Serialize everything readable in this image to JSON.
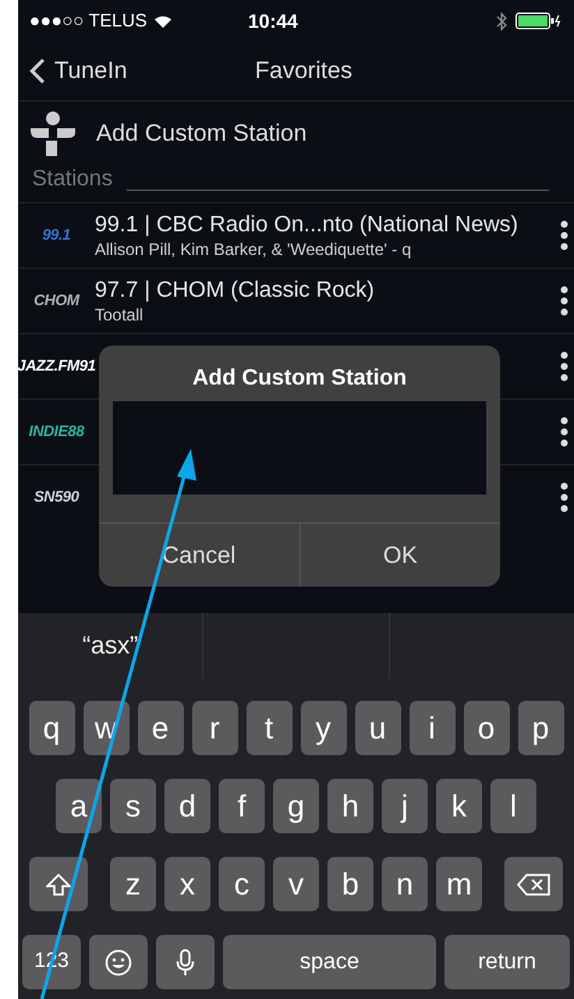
{
  "status_bar": {
    "carrier": "●●●○○ TELUS",
    "time": "10:44"
  },
  "nav": {
    "back": "TuneIn",
    "title": "Favorites"
  },
  "add_custom": {
    "label": "Add Custom Station"
  },
  "section": {
    "title": "Stations"
  },
  "stations": [
    {
      "logo": "99.1",
      "color": "#3a6fd8",
      "title": "99.1 | CBC Radio On...nto (National News)",
      "subtitle": "Allison Pill, Kim Barker, & 'Weediquette' - q"
    },
    {
      "logo": "CHOM",
      "color": "#b0b0b0",
      "title": "97.7 | CHOM (Classic Rock)",
      "subtitle": "Tootall"
    },
    {
      "logo": "JAZZ.FM91",
      "color": "#ffffff"
    },
    {
      "logo": "INDIE88",
      "color": "#2bb3a3"
    },
    {
      "logo": "SN590",
      "color": "#d0d0e0"
    }
  ],
  "dialog": {
    "title": "Add Custom Station",
    "buttons": [
      "Cancel",
      "OK"
    ]
  },
  "keyboard": {
    "suggestions": [
      "“asx”"
    ],
    "rows": [
      [
        "q",
        "w",
        "e",
        "r",
        "t",
        "y",
        "u",
        "i",
        "o",
        "p"
      ],
      [
        "a",
        "s",
        "d",
        "f",
        "g",
        "h",
        "j",
        "k",
        "l"
      ],
      [
        "z",
        "x",
        "c",
        "v",
        "b",
        "n",
        "m"
      ]
    ],
    "numbers": "123",
    "space": "space",
    "return": "return"
  }
}
